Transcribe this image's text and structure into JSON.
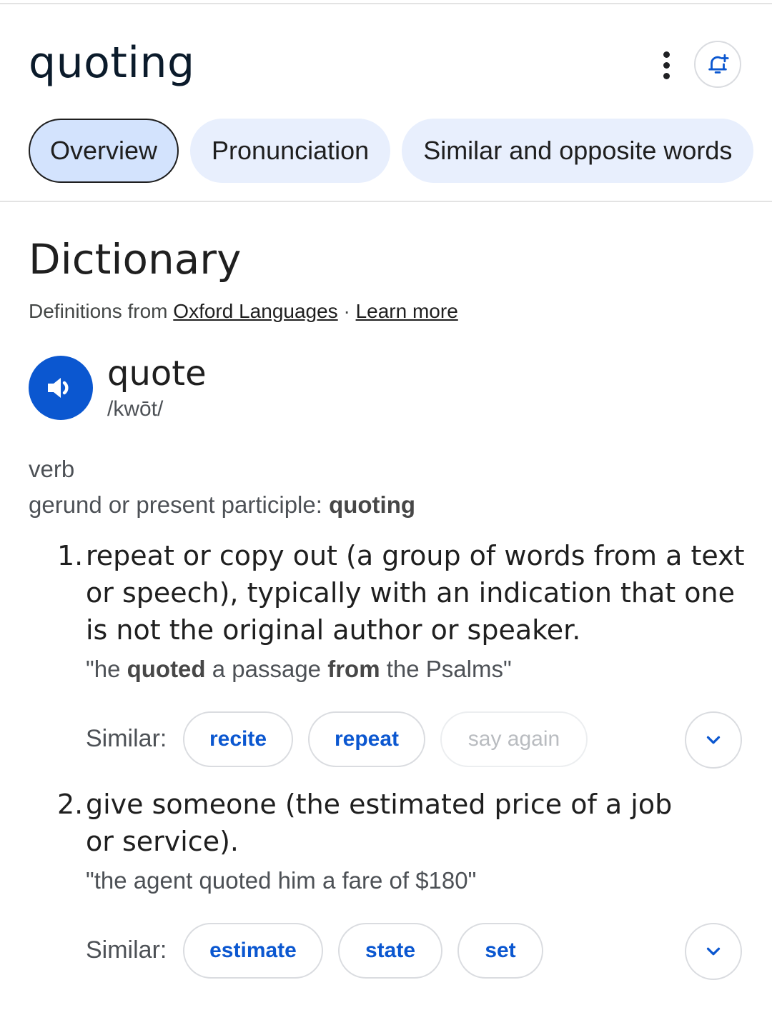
{
  "header": {
    "title": "quoting"
  },
  "tabs": [
    {
      "label": "Overview",
      "active": true
    },
    {
      "label": "Pronunciation",
      "active": false
    },
    {
      "label": "Similar and opposite words",
      "active": false
    }
  ],
  "dictionary": {
    "title": "Dictionary",
    "source_prefix": "Definitions from ",
    "source_link": "Oxford Languages",
    "separator": " · ",
    "learn_more": "Learn more",
    "headword": "quote",
    "phonetic": "/kwōt/",
    "part_of_speech": "verb",
    "gerund_label": "gerund or present participle: ",
    "gerund_value": "quoting",
    "similar_label": "Similar:",
    "senses": [
      {
        "number": "1.",
        "definition": "repeat or copy out (a group of words from a text or speech), typically with an indication that one is not the original author or speaker.",
        "example_parts": [
          "\"he ",
          "quoted",
          " a passage ",
          "from",
          " the Psalms\""
        ],
        "similar": [
          "recite",
          "repeat",
          "say again"
        ]
      },
      {
        "number": "2.",
        "definition": "give someone (the estimated price of a job or service).",
        "example": "\"the agent quoted him a fare of $180\"",
        "similar": [
          "estimate",
          "state",
          "set"
        ]
      }
    ]
  },
  "colors": {
    "accent": "#0b57d0",
    "tab_bg": "#e8effd",
    "tab_active_bg": "#d3e3fd"
  },
  "icons": [
    "more-vert-icon",
    "bell-add-icon",
    "speaker-icon",
    "chevron-down-icon"
  ]
}
